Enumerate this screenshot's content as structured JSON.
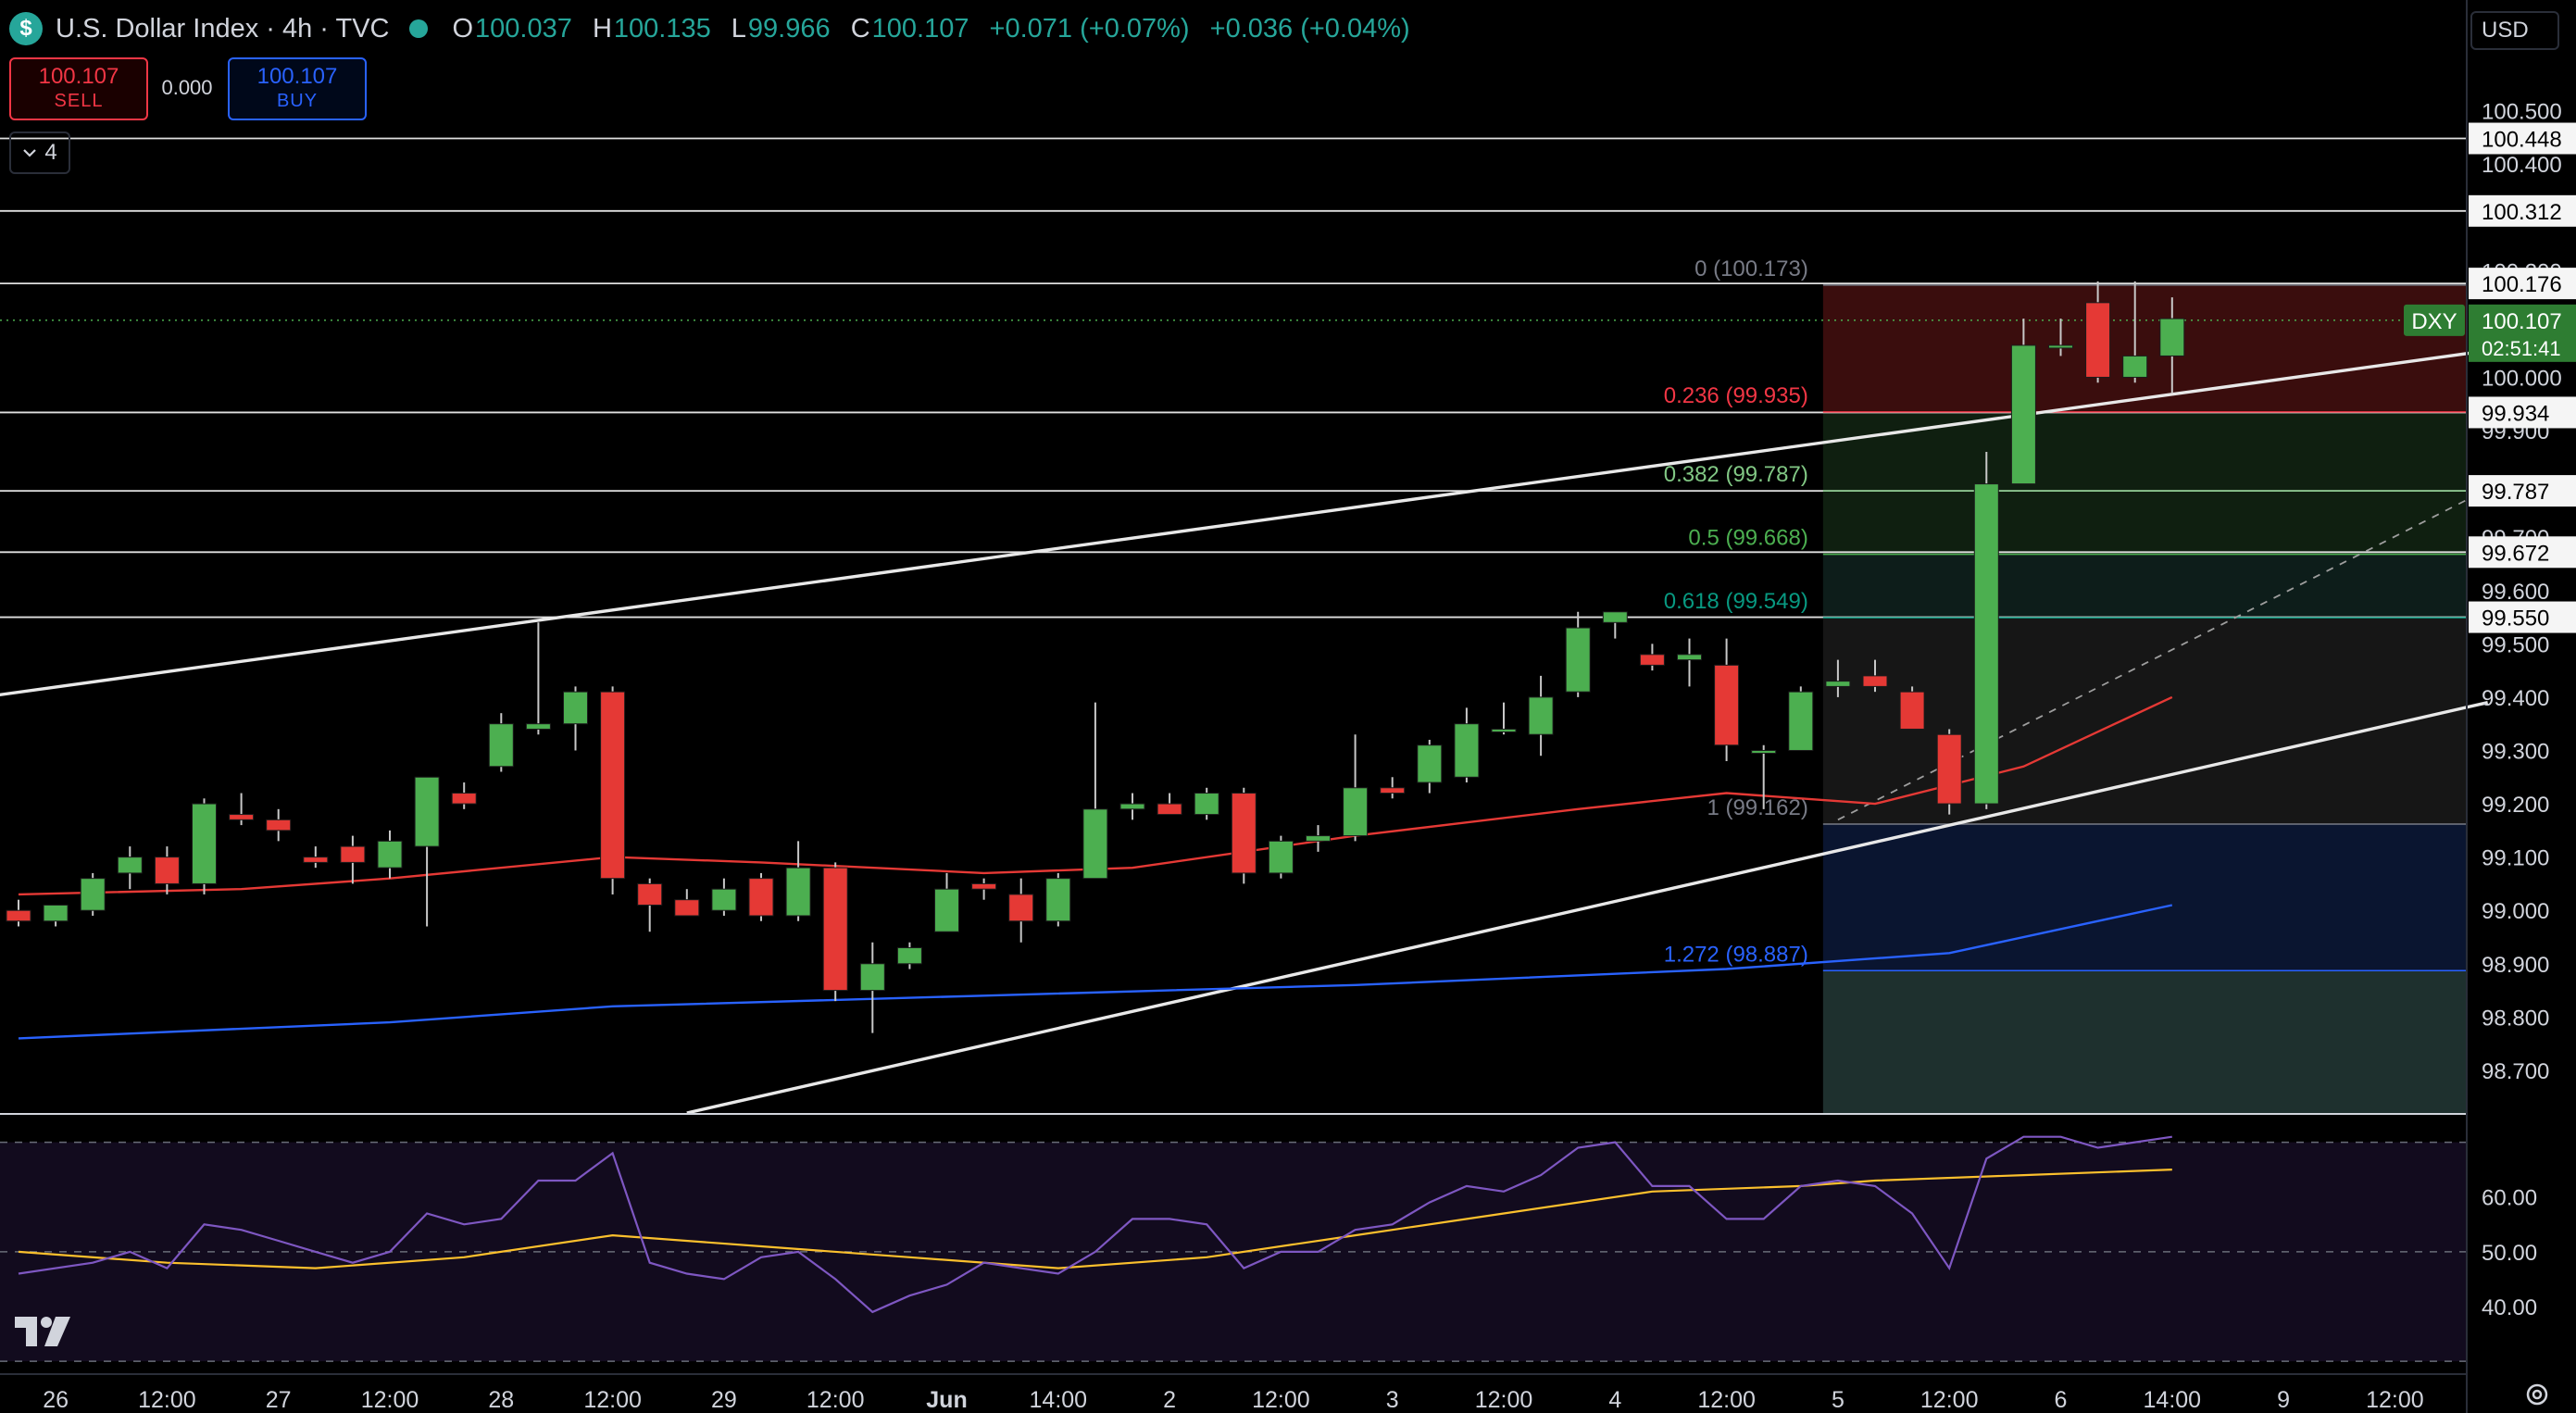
{
  "header": {
    "title": "U.S. Dollar Index · 4h · TVC",
    "open_key": "O",
    "open": "100.037",
    "high_key": "H",
    "high": "100.135",
    "low_key": "L",
    "low": "99.966",
    "close_key": "C",
    "close": "100.107",
    "change": "+0.071 (+0.07%)",
    "change2": "+0.036 (+0.04%)"
  },
  "trade": {
    "sell_price": "100.107",
    "sell_label": "SELL",
    "spread": "0.000",
    "buy_price": "100.107",
    "buy_label": "BUY"
  },
  "indicators_count": "4",
  "currency": "USD",
  "colors": {
    "up": "#4caf50",
    "down": "#e53935",
    "accent": "#26a69a",
    "ma_fast": "#e53935",
    "ma_slow": "#2962ff",
    "rsi": "#7e57c2",
    "rsi_ma": "#fbc02d"
  },
  "chart_data": {
    "type": "candlestick",
    "symbol": "DXY",
    "timeframe": "4h",
    "ylim": [
      98.62,
      100.6
    ],
    "price_ticks": [
      "100.500",
      "100.400",
      "100.300",
      "100.200",
      "100.100",
      "100.000",
      "99.900",
      "99.800",
      "99.700",
      "99.600",
      "99.500",
      "99.400",
      "99.300",
      "99.200",
      "99.100",
      "99.000",
      "98.900",
      "98.800",
      "98.700"
    ],
    "x_ticks": [
      {
        "i": 1,
        "label": "26"
      },
      {
        "i": 4,
        "label": "12:00"
      },
      {
        "i": 7,
        "label": "27"
      },
      {
        "i": 10,
        "label": "12:00"
      },
      {
        "i": 13,
        "label": "28"
      },
      {
        "i": 16,
        "label": "12:00"
      },
      {
        "i": 19,
        "label": "29"
      },
      {
        "i": 22,
        "label": "12:00"
      },
      {
        "i": 25,
        "label": "Jun"
      },
      {
        "i": 28,
        "label": "14:00"
      },
      {
        "i": 31,
        "label": "2"
      },
      {
        "i": 34,
        "label": "12:00"
      },
      {
        "i": 37,
        "label": "3"
      },
      {
        "i": 40,
        "label": "12:00"
      },
      {
        "i": 43,
        "label": "4"
      },
      {
        "i": 46,
        "label": "12:00"
      },
      {
        "i": 49,
        "label": "5"
      },
      {
        "i": 52,
        "label": "12:00"
      },
      {
        "i": 55,
        "label": "6"
      },
      {
        "i": 58,
        "label": "14:00"
      },
      {
        "i": 61,
        "label": "9"
      },
      {
        "i": 64,
        "label": "12:00"
      }
    ],
    "candles": [
      [
        99.0,
        99.02,
        98.97,
        98.98
      ],
      [
        98.98,
        99.01,
        98.97,
        99.01
      ],
      [
        99.0,
        99.07,
        98.99,
        99.06
      ],
      [
        99.07,
        99.12,
        99.04,
        99.1
      ],
      [
        99.1,
        99.12,
        99.03,
        99.05
      ],
      [
        99.05,
        99.21,
        99.03,
        99.2
      ],
      [
        99.18,
        99.22,
        99.16,
        99.17
      ],
      [
        99.17,
        99.19,
        99.13,
        99.15
      ],
      [
        99.1,
        99.12,
        99.08,
        99.09
      ],
      [
        99.12,
        99.14,
        99.05,
        99.09
      ],
      [
        99.08,
        99.15,
        99.06,
        99.13
      ],
      [
        99.12,
        99.25,
        98.97,
        99.25
      ],
      [
        99.22,
        99.24,
        99.19,
        99.2
      ],
      [
        99.27,
        99.37,
        99.26,
        99.35
      ],
      [
        99.34,
        99.54,
        99.33,
        99.35
      ],
      [
        99.35,
        99.42,
        99.3,
        99.41
      ],
      [
        99.41,
        99.42,
        99.03,
        99.06
      ],
      [
        99.05,
        99.06,
        98.96,
        99.01
      ],
      [
        99.02,
        99.04,
        98.99,
        98.99
      ],
      [
        99.0,
        99.06,
        98.99,
        99.04
      ],
      [
        99.06,
        99.07,
        98.98,
        98.99
      ],
      [
        98.99,
        99.13,
        98.98,
        99.08
      ],
      [
        99.08,
        99.09,
        98.83,
        98.85
      ],
      [
        98.85,
        98.94,
        98.77,
        98.9
      ],
      [
        98.9,
        98.94,
        98.89,
        98.93
      ],
      [
        98.96,
        99.07,
        98.96,
        99.04
      ],
      [
        99.05,
        99.06,
        99.02,
        99.04
      ],
      [
        99.03,
        99.06,
        98.94,
        98.98
      ],
      [
        98.98,
        99.07,
        98.97,
        99.06
      ],
      [
        99.06,
        99.39,
        99.06,
        99.19
      ],
      [
        99.19,
        99.22,
        99.17,
        99.2
      ],
      [
        99.2,
        99.22,
        99.19,
        99.18
      ],
      [
        99.18,
        99.23,
        99.17,
        99.22
      ],
      [
        99.22,
        99.23,
        99.05,
        99.07
      ],
      [
        99.07,
        99.14,
        99.06,
        99.13
      ],
      [
        99.13,
        99.16,
        99.11,
        99.14
      ],
      [
        99.14,
        99.33,
        99.13,
        99.23
      ],
      [
        99.23,
        99.25,
        99.21,
        99.22
      ],
      [
        99.24,
        99.32,
        99.22,
        99.31
      ],
      [
        99.25,
        99.38,
        99.24,
        99.35
      ],
      [
        99.34,
        99.39,
        99.33,
        99.34
      ],
      [
        99.33,
        99.44,
        99.29,
        99.4
      ],
      [
        99.41,
        99.56,
        99.4,
        99.53
      ],
      [
        99.54,
        99.56,
        99.51,
        99.56
      ],
      [
        99.48,
        99.5,
        99.45,
        99.46
      ],
      [
        99.47,
        99.51,
        99.42,
        99.48
      ],
      [
        99.46,
        99.51,
        99.28,
        99.31
      ],
      [
        99.3,
        99.31,
        99.19,
        99.3
      ],
      [
        99.3,
        99.42,
        99.3,
        99.41
      ],
      [
        99.42,
        99.47,
        99.4,
        99.43
      ],
      [
        99.44,
        99.47,
        99.41,
        99.42
      ],
      [
        99.41,
        99.42,
        99.34,
        99.34
      ],
      [
        99.33,
        99.34,
        99.18,
        99.2
      ],
      [
        99.2,
        99.86,
        99.19,
        99.8
      ],
      [
        99.8,
        100.11,
        99.8,
        100.06
      ],
      [
        100.06,
        100.11,
        100.04,
        100.06
      ],
      [
        100.14,
        100.18,
        99.99,
        100.0
      ],
      [
        100.0,
        100.18,
        99.99,
        100.04
      ],
      [
        100.04,
        100.15,
        99.97,
        100.11
      ]
    ],
    "ma_fast": [
      [
        0,
        99.03
      ],
      [
        6,
        99.04
      ],
      [
        10,
        99.06
      ],
      [
        16,
        99.1
      ],
      [
        20,
        99.09
      ],
      [
        26,
        99.07
      ],
      [
        30,
        99.08
      ],
      [
        36,
        99.14
      ],
      [
        42,
        99.19
      ],
      [
        46,
        99.22
      ],
      [
        50,
        99.2
      ],
      [
        54,
        99.27
      ],
      [
        58,
        99.4
      ]
    ],
    "ma_slow": [
      [
        0,
        98.76
      ],
      [
        10,
        98.79
      ],
      [
        16,
        98.82
      ],
      [
        26,
        98.84
      ],
      [
        36,
        98.86
      ],
      [
        46,
        98.89
      ],
      [
        52,
        98.92
      ],
      [
        58,
        99.01
      ]
    ],
    "trendlines": [
      {
        "from": [
          -2,
          99.39
        ],
        "to": [
          66.5,
          100.05
        ]
      },
      {
        "from": [
          18,
          98.62
        ],
        "to": [
          66.5,
          99.39
        ]
      },
      {
        "from": [
          49,
          99.17
        ],
        "to": [
          66.5,
          99.79
        ],
        "dashed": true
      }
    ],
    "horizontal_levels": [
      {
        "price": 100.448,
        "label": "100.448"
      },
      {
        "price": 100.312,
        "label": "100.312"
      },
      {
        "price": 100.176,
        "label": "100.176"
      },
      {
        "price": 99.934,
        "label": "99.934"
      },
      {
        "price": 99.787,
        "label": "99.787"
      },
      {
        "price": 99.672,
        "label": "99.672"
      },
      {
        "price": 99.55,
        "label": "99.550"
      }
    ],
    "fibonacci": {
      "start_index": 49,
      "levels": [
        {
          "ratio": "0",
          "price": 100.173,
          "label": "0 (100.173)",
          "color": "#787b86"
        },
        {
          "ratio": "0.236",
          "price": 99.935,
          "label": "0.236 (99.935)",
          "color": "#f23645"
        },
        {
          "ratio": "0.382",
          "price": 99.787,
          "label": "0.382 (99.787)",
          "color": "#81c784"
        },
        {
          "ratio": "0.5",
          "price": 99.668,
          "label": "0.5 (99.668)",
          "color": "#4caf50"
        },
        {
          "ratio": "0.618",
          "price": 99.549,
          "label": "0.618 (99.549)",
          "color": "#089981"
        },
        {
          "ratio": "1",
          "price": 99.162,
          "label": "1 (99.162)",
          "color": "#787b86"
        },
        {
          "ratio": "1.272",
          "price": 98.887,
          "label": "1.272 (98.887)",
          "color": "#2962ff"
        }
      ],
      "zones": [
        {
          "top": 100.173,
          "bottom": 99.935,
          "color": "#3a0d0d"
        },
        {
          "top": 99.935,
          "bottom": 99.787,
          "color": "#0f1f10"
        },
        {
          "top": 99.787,
          "bottom": 99.668,
          "color": "#0f1f10"
        },
        {
          "top": 99.668,
          "bottom": 99.549,
          "color": "#0d1d1a"
        },
        {
          "top": 99.549,
          "bottom": 99.162,
          "color": "#161616"
        },
        {
          "top": 99.162,
          "bottom": 98.887,
          "color": "#0a1530"
        },
        {
          "top": 98.887,
          "bottom": 98.62,
          "color": "#1e302e"
        }
      ]
    },
    "current": {
      "symbol": "DXY",
      "price": "100.107",
      "countdown": "02:51:41",
      "value": 100.107
    },
    "rsi": {
      "ylim": [
        28,
        75
      ],
      "ticks": [
        "60.00",
        "50.00",
        "40.00"
      ],
      "bands": [
        70,
        50,
        30
      ],
      "values": [
        [
          0,
          46
        ],
        [
          2,
          48
        ],
        [
          3,
          50
        ],
        [
          4,
          47
        ],
        [
          5,
          55
        ],
        [
          6,
          54
        ],
        [
          7,
          52
        ],
        [
          8,
          50
        ],
        [
          9,
          48
        ],
        [
          10,
          50
        ],
        [
          11,
          57
        ],
        [
          12,
          55
        ],
        [
          13,
          56
        ],
        [
          14,
          63
        ],
        [
          15,
          63
        ],
        [
          16,
          68
        ],
        [
          17,
          48
        ],
        [
          18,
          46
        ],
        [
          19,
          45
        ],
        [
          20,
          49
        ],
        [
          21,
          50
        ],
        [
          22,
          45
        ],
        [
          23,
          39
        ],
        [
          24,
          42
        ],
        [
          25,
          44
        ],
        [
          26,
          48
        ],
        [
          27,
          47
        ],
        [
          28,
          46
        ],
        [
          29,
          50
        ],
        [
          30,
          56
        ],
        [
          31,
          56
        ],
        [
          32,
          55
        ],
        [
          33,
          47
        ],
        [
          34,
          50
        ],
        [
          35,
          50
        ],
        [
          36,
          54
        ],
        [
          37,
          55
        ],
        [
          38,
          59
        ],
        [
          39,
          62
        ],
        [
          40,
          61
        ],
        [
          41,
          64
        ],
        [
          42,
          69
        ],
        [
          43,
          70
        ],
        [
          44,
          62
        ],
        [
          45,
          62
        ],
        [
          46,
          56
        ],
        [
          47,
          56
        ],
        [
          48,
          62
        ],
        [
          49,
          63
        ],
        [
          50,
          62
        ],
        [
          51,
          57
        ],
        [
          52,
          47
        ],
        [
          53,
          67
        ],
        [
          54,
          71
        ],
        [
          55,
          71
        ],
        [
          56,
          69
        ],
        [
          57,
          70
        ],
        [
          58,
          71
        ]
      ],
      "ma": [
        [
          0,
          50
        ],
        [
          4,
          48
        ],
        [
          8,
          47
        ],
        [
          12,
          49
        ],
        [
          16,
          53
        ],
        [
          20,
          51
        ],
        [
          24,
          49
        ],
        [
          28,
          47
        ],
        [
          32,
          49
        ],
        [
          36,
          53
        ],
        [
          40,
          57
        ],
        [
          44,
          61
        ],
        [
          48,
          62
        ],
        [
          50,
          63
        ],
        [
          54,
          64
        ],
        [
          58,
          65
        ]
      ]
    }
  }
}
